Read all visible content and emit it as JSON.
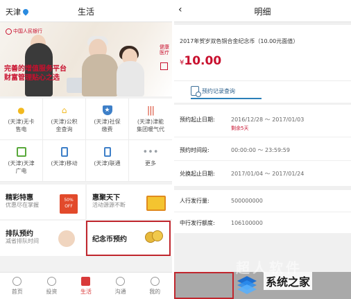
{
  "left": {
    "header": {
      "city": "天津",
      "title": "生活"
    },
    "banner": {
      "bank_name": "中国人民银行",
      "slogan_line1": "完善的增值服务平台",
      "slogan_line2": "财富管理贴心之选",
      "side_label": "健康医疗"
    },
    "services": [
      {
        "icon": "lightbulb-icon",
        "label": "(天津)无卡\n售电",
        "color": "#f2b91f"
      },
      {
        "icon": "house-icon",
        "label": "(天津)公积\n金查询",
        "color": "#f2b91f"
      },
      {
        "icon": "shield-icon",
        "label": "(天津)社保\n缴费",
        "color": "#3d7fc8"
      },
      {
        "icon": "radiator-icon",
        "label": "(天津)津能\n集团暖气代",
        "color": "#d9472f"
      },
      {
        "icon": "tv-icon",
        "label": "(天津)天津\n广电",
        "color": "#58a83a"
      },
      {
        "icon": "phone-icon",
        "label": "(天津)移动",
        "color": "#3d7fc8"
      },
      {
        "icon": "phone-icon",
        "label": "(天津)联通",
        "color": "#3d7fc8"
      },
      {
        "icon": "more-icon",
        "label": "更多",
        "color": "#9aa0a6"
      }
    ],
    "promos": [
      {
        "title": "精彩特惠",
        "subtitle": "优惠尽在掌握",
        "badge": "50% OFF"
      },
      {
        "title": "惠聚天下",
        "subtitle": "活动源源不断"
      },
      {
        "title": "排队预约",
        "subtitle": "减省排队时间"
      },
      {
        "title": "纪念币预约",
        "subtitle": ""
      }
    ],
    "tabs": [
      {
        "label": "首页",
        "active": false
      },
      {
        "label": "投资",
        "active": false
      },
      {
        "label": "生活",
        "active": true
      },
      {
        "label": "沟通",
        "active": false
      },
      {
        "label": "我的",
        "active": false
      }
    ]
  },
  "right": {
    "header": {
      "back": "‹",
      "title": "明细"
    },
    "coin": {
      "name": "2017年贺岁双色铜合金纪念币（10.00元面值）",
      "currency": "¥",
      "price": "10.00",
      "query_link": "预约记录查询"
    },
    "details": [
      {
        "key": "预约起止日期:",
        "value": "2016/12/28 ～ 2017/01/03",
        "note": "剩余5天"
      },
      {
        "key": "预约时间段:",
        "value": "00:00:00 ～ 23:59:59"
      },
      {
        "key": "兑换起止日期:",
        "value": "2017/01/04 ～ 2017/01/24"
      }
    ],
    "issue": [
      {
        "key": "人行发行量:",
        "value": "500000000"
      },
      {
        "key": "中行发行额度:",
        "value": "106100000"
      }
    ]
  },
  "watermark": {
    "text": "超人软件",
    "site": "系统之家"
  }
}
